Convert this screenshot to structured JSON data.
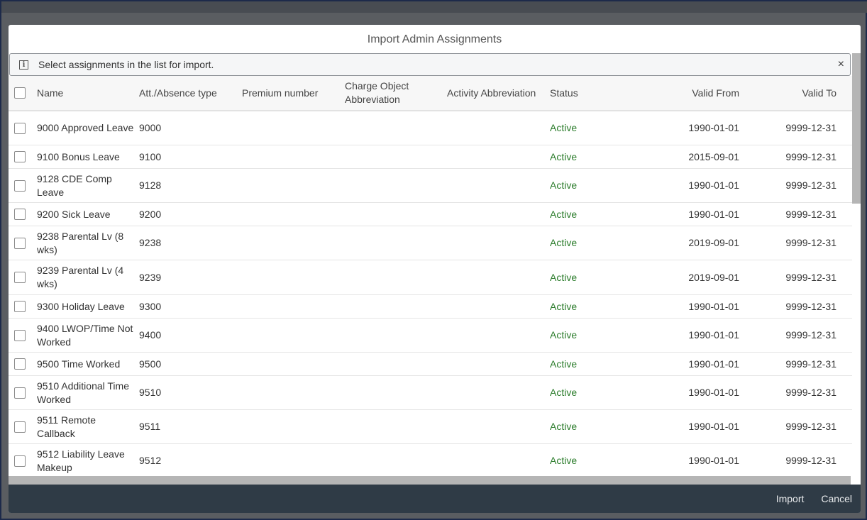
{
  "dialog": {
    "title": "Import Admin Assignments",
    "message": "Select assignments in the list for import.",
    "close_glyph": "×",
    "info_glyph": "i"
  },
  "columns": [
    "Name",
    "Att./Absence type",
    "Premium number",
    "Charge Object Abbreviation",
    "Activity Abbreviation",
    "Status",
    "Valid From",
    "Valid To"
  ],
  "rows": [
    {
      "name": "9000 Approved Leave",
      "type": "9000",
      "status": "Active",
      "from": "1990-01-01",
      "to": "9999-12-31"
    },
    {
      "name": "9100 Bonus Leave",
      "type": "9100",
      "status": "Active",
      "from": "2015-09-01",
      "to": "9999-12-31"
    },
    {
      "name": "9128 CDE Comp Leave",
      "type": "9128",
      "status": "Active",
      "from": "1990-01-01",
      "to": "9999-12-31"
    },
    {
      "name": "9200 Sick Leave",
      "type": "9200",
      "status": "Active",
      "from": "1990-01-01",
      "to": "9999-12-31"
    },
    {
      "name": "9238 Parental Lv (8 wks)",
      "type": "9238",
      "status": "Active",
      "from": "2019-09-01",
      "to": "9999-12-31"
    },
    {
      "name": "9239 Parental Lv (4 wks)",
      "type": "9239",
      "status": "Active",
      "from": "2019-09-01",
      "to": "9999-12-31"
    },
    {
      "name": "9300 Holiday Leave",
      "type": "9300",
      "status": "Active",
      "from": "1990-01-01",
      "to": "9999-12-31"
    },
    {
      "name": "9400 LWOP/Time Not Worked",
      "type": "9400",
      "status": "Active",
      "from": "1990-01-01",
      "to": "9999-12-31"
    },
    {
      "name": "9500 Time Worked",
      "type": "9500",
      "status": "Active",
      "from": "1990-01-01",
      "to": "9999-12-31"
    },
    {
      "name": "9510 Additional Time Worked",
      "type": "9510",
      "status": "Active",
      "from": "1990-01-01",
      "to": "9999-12-31"
    },
    {
      "name": "9511 Remote Callback",
      "type": "9511",
      "status": "Active",
      "from": "1990-01-01",
      "to": "9999-12-31"
    },
    {
      "name": "9512 Liability Leave Makeup",
      "type": "9512",
      "status": "Active",
      "from": "1990-01-01",
      "to": "9999-12-31"
    }
  ],
  "footer": {
    "import": "Import",
    "cancel": "Cancel"
  },
  "colors": {
    "active": "#2b7c2b",
    "footer": "#2f3b46"
  }
}
